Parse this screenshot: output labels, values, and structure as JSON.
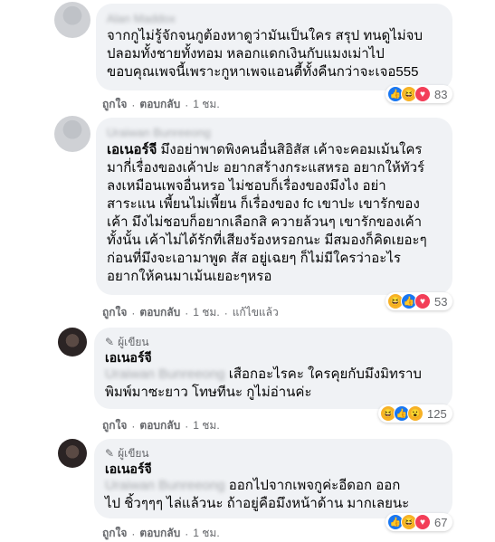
{
  "comments": [
    {
      "name": "Alan Maddox",
      "text": "จากกูไม่รู้จักจนกูต้องหาดูว่ามันเป็นใคร สรุป ทนดูไม่จบ\nปลอมทั้งชายทั้งทอม หลอกแดกเงินกับแมงเม่าไป\nขอบคุณเพจนี้เพราะกูหาเพจแอนตี้ทั้งคืนกว่าจะเจอ555",
      "reaction_count": "83",
      "like": "ถูกใจ",
      "reply": "ตอบกลับ",
      "time": "1 ชม."
    },
    {
      "name": "Uraiwan Bunreeong",
      "text_prefix": "เอเนอร์จี",
      "text": " มึงอย่าพาดพิงคนอื่นสิอิสัส เค้าจะคอมเม้นใคร\nมากี่เรื่องของเค้าปะ อยากสร้างกระแสหรอ อยากให้ทัวร์\nลงเหมือนเพจอื่นหรอ ไม่ชอบก็เรื่องของมึงไง อย่า\nสาระแน เพี้ยนไม่เพี้ยน ก็เรื่องของ fc เขาปะ เขารักของ\nเค้า มึงไม่ชอบก็อยากเลือกสิ ควายล้วนๆ เขารักของเค้า\nทั้งนั้น เค้าไม่ได้รักที่เสียงร้องหรอกนะ มีสมองก็คิดเยอะๆ\nก่อนที่มึงจะเอามาพูด สัส อยู่เฉยๆ ก็ไม่มีใครว่าอะไร\nอยากให้คนมาเม้นเยอะๆหรอ",
      "reaction_count": "53",
      "like": "ถูกใจ",
      "reply": "ตอบกลับ",
      "time": "1 ชม.",
      "edited": "แก้ไขแล้ว"
    },
    {
      "author_tag": "ผู้เขียน",
      "name": "เอเนอร์จี",
      "mention": "Uraiwan Bunreeong",
      "text": " เสือกอะไรคะ ใครคุยกับมึงมิทราบ\nพิมพ์มาซะยาว โทษทีนะ กูไม่อ่านค่ะ",
      "reaction_count": "125",
      "like": "ถูกใจ",
      "reply": "ตอบกลับ",
      "time": "1 ชม."
    },
    {
      "author_tag": "ผู้เขียน",
      "name": "เอเนอร์จี",
      "mention": "Uraiwan Bunreeong",
      "text": " ออกไปจากเพจกูค่ะอีดอก ออก\nไป ชิ้วๆๆๆ ไล่แล้วนะ ถ้าอยู่คือมึงหน้าด้าน มากเลยนะ",
      "reaction_count": "67",
      "like": "ถูกใจ",
      "reply": "ตอบกลับ",
      "time": "1 ชม."
    }
  ],
  "separator": "·"
}
